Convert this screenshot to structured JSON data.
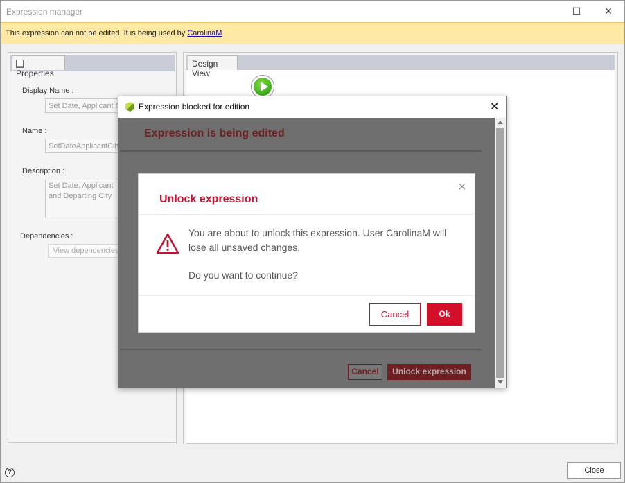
{
  "window": {
    "title": "Expression manager",
    "minimize_glyph": "—",
    "maximize_glyph": "☐",
    "close_glyph": "✕"
  },
  "warning_bar": {
    "text": "This expression can not be edited. It is being used by ",
    "user": "CarolinaM"
  },
  "tabs": {
    "properties": "Properties",
    "design_view": "Design View"
  },
  "properties": {
    "display_name_label": "Display Name :",
    "display_name_value": "Set Date, Applicant City",
    "name_label": "Name :",
    "name_value": "SetDateApplicantCity",
    "description_label": "Description :",
    "description_value": "Set Date, Applicant and Departing City",
    "dependencies_label": "Dependencies :",
    "view_dependencies_button": "View dependencies"
  },
  "blocked_dialog": {
    "title": "Expression blocked for edition",
    "heading": "Expression is being edited",
    "cancel_button": "Cancel",
    "unlock_button": "Unlock expression",
    "close_glyph": "✕"
  },
  "confirm_modal": {
    "title": "Unlock expression",
    "message": "You are about to unlock this expression. User CarolinaM will lose all unsaved changes.",
    "question": "Do you want to continue?",
    "cancel_button": "Cancel",
    "ok_button": "Ok",
    "close_glyph": "×"
  },
  "footer": {
    "help_glyph": "?",
    "close_button": "Close"
  },
  "colors": {
    "warning_bg": "#fde9a3",
    "accent_red": "#c8102e",
    "dark_red": "#6e1f22",
    "overlay_gray": "#6f6f6f"
  }
}
